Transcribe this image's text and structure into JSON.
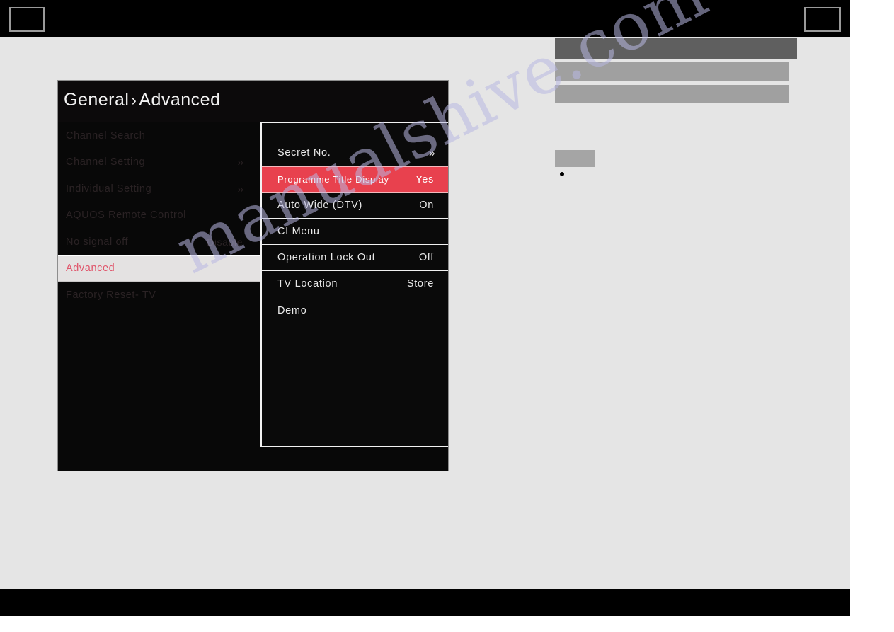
{
  "page": {
    "background_color": "#e5e5e5",
    "bar_color": "#000000",
    "watermark_text": "manualshive.com"
  },
  "header": {
    "left_box_label": "",
    "right_box_label": ""
  },
  "right_column": {
    "text_bars": [
      {
        "name": "heading-bar",
        "color": "#5f5f5f"
      },
      {
        "name": "body-bar-1",
        "color": "#a0a0a0"
      },
      {
        "name": "body-bar-2",
        "color": "#a0a0a0"
      }
    ],
    "label_chip_color": "#a5a5a5",
    "bullet_color": "#000000"
  },
  "tv_menu": {
    "title_primary": "General",
    "title_separator": "›",
    "title_secondary": "Advanced",
    "accent_color": "#e8414e",
    "selected_text_color": "#e0556b",
    "sidebar": [
      {
        "label": "Channel Search",
        "value": "",
        "arrow": ""
      },
      {
        "label": "Channel Setting",
        "value": "",
        "arrow": "››"
      },
      {
        "label": "Individual Setting",
        "value": "",
        "arrow": "››"
      },
      {
        "label": "AQUOS Remote Control",
        "value": "",
        "arrow": "››"
      },
      {
        "label": "No signal off",
        "value": "Disable",
        "arrow": ""
      },
      {
        "label": "Advanced",
        "value": "",
        "arrow": "",
        "selected": true
      },
      {
        "label": "Factory Reset- TV",
        "value": "",
        "arrow": ""
      }
    ],
    "submenu": [
      {
        "label": "Secret No.",
        "value": "",
        "arrow": "››"
      },
      {
        "label": "Programme Title Display",
        "value": "Yes",
        "arrow": "",
        "highlighted": true
      },
      {
        "label": "Auto Wide (DTV)",
        "value": "On",
        "arrow": ""
      },
      {
        "label": "CI Menu",
        "value": "",
        "arrow": ""
      },
      {
        "label": "Operation Lock Out",
        "value": "Off",
        "arrow": ""
      },
      {
        "label": "TV Location",
        "value": "Store",
        "arrow": ""
      },
      {
        "label": "Demo",
        "value": "",
        "arrow": ""
      }
    ]
  }
}
